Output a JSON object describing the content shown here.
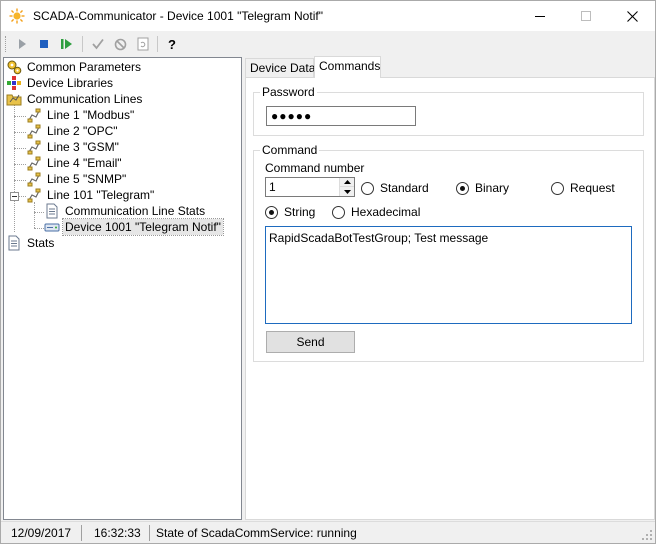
{
  "window": {
    "title": "SCADA-Communicator - Device 1001 \"Telegram Notif\""
  },
  "toolbar": {
    "buttons": [
      {
        "name": "start-icon",
        "color": "#9aa0a6"
      },
      {
        "name": "stop-icon",
        "color": "#1f5fbf"
      },
      {
        "name": "restart-icon",
        "color": "#2e9e3f"
      },
      {
        "name": "apply-icon",
        "color": "#a0a0a0"
      },
      {
        "name": "cancel-icon",
        "color": "#a0a0a0"
      },
      {
        "name": "refresh-icon",
        "color": "#a0a0a0"
      },
      {
        "name": "help-icon",
        "color": "#000000"
      }
    ]
  },
  "tree": {
    "common_parameters": "Common Parameters",
    "device_libraries": "Device Libraries",
    "communication_lines": "Communication Lines",
    "lines": [
      "Line 1 \"Modbus\"",
      "Line 2 \"OPC\"",
      "Line 3 \"GSM\"",
      "Line 4 \"Email\"",
      "Line 5 \"SNMP\"",
      "Line 101 \"Telegram\""
    ],
    "line_children": [
      "Communication Line Stats",
      "Device 1001 \"Telegram Notif\""
    ],
    "stats": "Stats",
    "selected": "Device 1001 \"Telegram Notif\""
  },
  "tabs": [
    {
      "label": "Device Data",
      "active": false
    },
    {
      "label": "Commands",
      "active": true
    }
  ],
  "commands": {
    "password_group": "Password",
    "password_value": "●●●●●",
    "command_group": "Command",
    "command_number_label": "Command number",
    "command_number_value": "1",
    "type_options": [
      {
        "label": "Standard",
        "selected": false
      },
      {
        "label": "Binary",
        "selected": true
      },
      {
        "label": "Request",
        "selected": false
      }
    ],
    "format_options": [
      {
        "label": "String",
        "selected": true
      },
      {
        "label": "Hexadecimal",
        "selected": false
      }
    ],
    "command_text": "RapidScadaBotTestGroup; Test message",
    "send_label": "Send"
  },
  "status": {
    "date": "12/09/2017",
    "time": "16:32:33",
    "service_state": "State of ScadaCommService: running"
  },
  "colors": {
    "accent": "#1e6bbf",
    "folder": "#e8c24a"
  }
}
